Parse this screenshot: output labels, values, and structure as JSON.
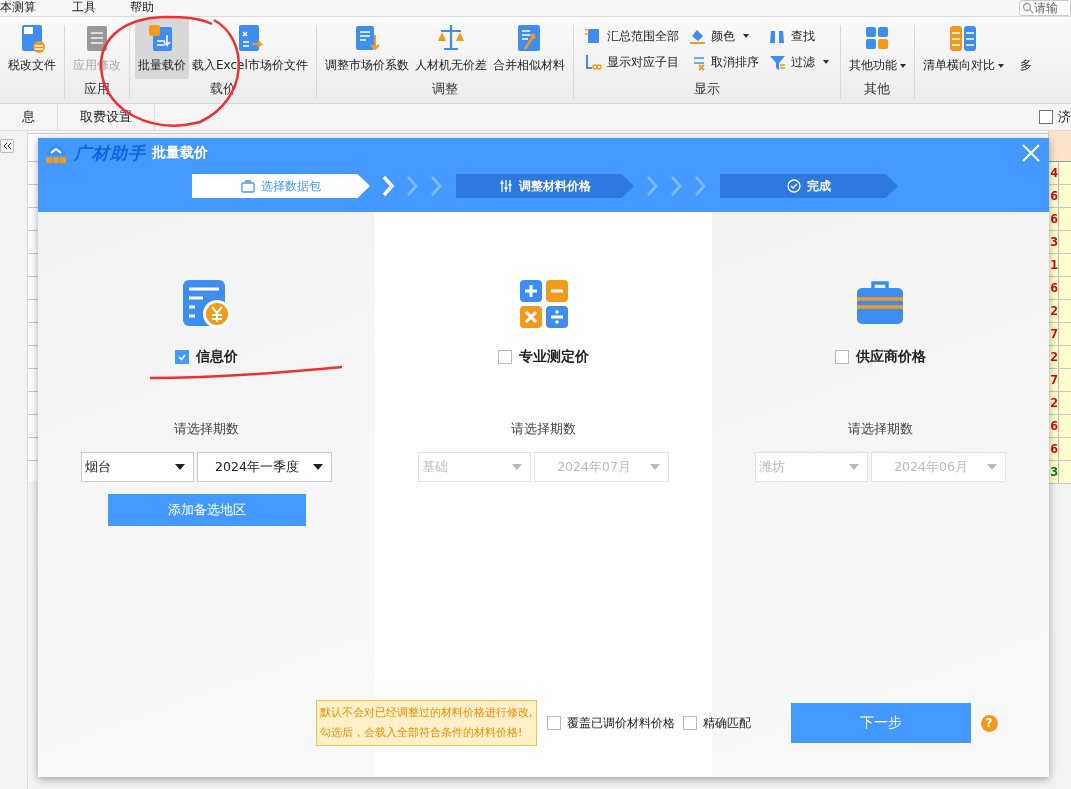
{
  "menu": [
    {
      "label": "本测算"
    },
    {
      "label": "工具"
    },
    {
      "label": "帮助"
    }
  ],
  "search": {
    "placeholder": "请输"
  },
  "ribbon": {
    "groups": [
      {
        "items": [
          {
            "label": "税改文件",
            "kind": "large",
            "selected": false,
            "disabled": false,
            "dropdown": false
          }
        ]
      },
      {
        "label": "应用",
        "items": [
          {
            "label": "应用修改",
            "kind": "large",
            "selected": false,
            "disabled": true,
            "dropdown": false
          }
        ]
      },
      {
        "label": "载价",
        "items": [
          {
            "label": "批量载价",
            "kind": "large",
            "selected": true,
            "disabled": false,
            "dropdown": false
          },
          {
            "label": "载入Excel市场价文件",
            "kind": "large",
            "selected": false,
            "disabled": false,
            "dropdown": false
          }
        ]
      },
      {
        "label": "调整",
        "items": [
          {
            "label": "调整市场价系数",
            "kind": "large",
            "selected": false,
            "disabled": false,
            "dropdown": false
          },
          {
            "label": "人材机无价差",
            "kind": "large",
            "selected": false,
            "disabled": false,
            "dropdown": false
          },
          {
            "label": "合并相似材料",
            "kind": "large",
            "selected": false,
            "disabled": false,
            "dropdown": false
          }
        ]
      },
      {
        "label": "显示",
        "items": [
          {
            "label": "汇总范围全部",
            "kind": "small",
            "selected": false,
            "disabled": false,
            "dropdown": false
          },
          {
            "label": "显示对应子目",
            "kind": "small",
            "selected": false,
            "disabled": false,
            "dropdown": false
          },
          {
            "label": "颜色",
            "kind": "small",
            "selected": false,
            "disabled": false,
            "dropdown": true
          },
          {
            "label": "取消排序",
            "kind": "small",
            "selected": false,
            "disabled": false,
            "dropdown": false
          },
          {
            "label": "查找",
            "kind": "small",
            "selected": false,
            "disabled": false,
            "dropdown": false
          },
          {
            "label": "过滤",
            "kind": "small",
            "selected": false,
            "disabled": false,
            "dropdown": true
          }
        ]
      },
      {
        "label": "其他",
        "items": [
          {
            "label": "其他功能",
            "kind": "large",
            "selected": false,
            "disabled": false,
            "dropdown": true
          }
        ]
      },
      {
        "items": [
          {
            "label": "清单横向对比",
            "kind": "large",
            "selected": false,
            "disabled": false,
            "dropdown": true
          },
          {
            "label": "多",
            "kind": "large",
            "selected": false,
            "disabled": false,
            "dropdown": false
          }
        ]
      }
    ]
  },
  "tabs": [
    {
      "label": "息",
      "selected": false
    },
    {
      "label": "取费设置",
      "selected": false
    }
  ],
  "filter_checkbox": {
    "label": "济",
    "checked": false
  },
  "column_values": [
    {
      "text": "4",
      "color": "#e00000"
    },
    {
      "text": "6",
      "color": "#e00000"
    },
    {
      "text": "6",
      "color": "#e00000"
    },
    {
      "text": "3",
      "color": "#e00000"
    },
    {
      "text": "1",
      "color": "#e00000"
    },
    {
      "text": "6",
      "color": "#e00000"
    },
    {
      "text": "2",
      "color": "#e00000"
    },
    {
      "text": "7",
      "color": "#e00000"
    },
    {
      "text": "2",
      "color": "#e00000"
    },
    {
      "text": "7",
      "color": "#e00000"
    },
    {
      "text": "2",
      "color": "#e00000"
    },
    {
      "text": "6",
      "color": "#e00000"
    },
    {
      "text": "6",
      "color": "#e00000"
    },
    {
      "text": "3",
      "color": "#008000"
    }
  ],
  "dialog": {
    "brand": "广材助手",
    "title": "批量载价",
    "steps": [
      {
        "label": "选择数据包",
        "selected": true
      },
      {
        "label": "调整材料价格",
        "selected": false
      },
      {
        "label": "完成",
        "selected": false
      }
    ],
    "sources": [
      {
        "label": "信息价",
        "checked": true,
        "period_label": "请选择期数",
        "selects": [
          {
            "value": "烟台",
            "disabled": false
          },
          {
            "value": "2024年一季度",
            "disabled": false
          }
        ],
        "add_button": "添加备选地区"
      },
      {
        "label": "专业测定价",
        "checked": false,
        "period_label": "请选择期数",
        "selects": [
          {
            "value": "基础",
            "disabled": true
          },
          {
            "value": "2024年07月",
            "disabled": true
          }
        ]
      },
      {
        "label": "供应商价格",
        "checked": false,
        "period_label": "请选择期数",
        "selects": [
          {
            "value": "潍坊",
            "disabled": true
          },
          {
            "value": "2024年06月",
            "disabled": true
          }
        ]
      }
    ],
    "tooltip": [
      "默认不会对已经调整过的材料价格进行修改,",
      "勾选后，会载入全部符合条件的材料价格!"
    ],
    "options": [
      {
        "label": "覆盖已调价材料价格",
        "checked": false
      },
      {
        "label": "精确匹配",
        "checked": false
      }
    ],
    "next_button": "下一步",
    "help": "?"
  }
}
